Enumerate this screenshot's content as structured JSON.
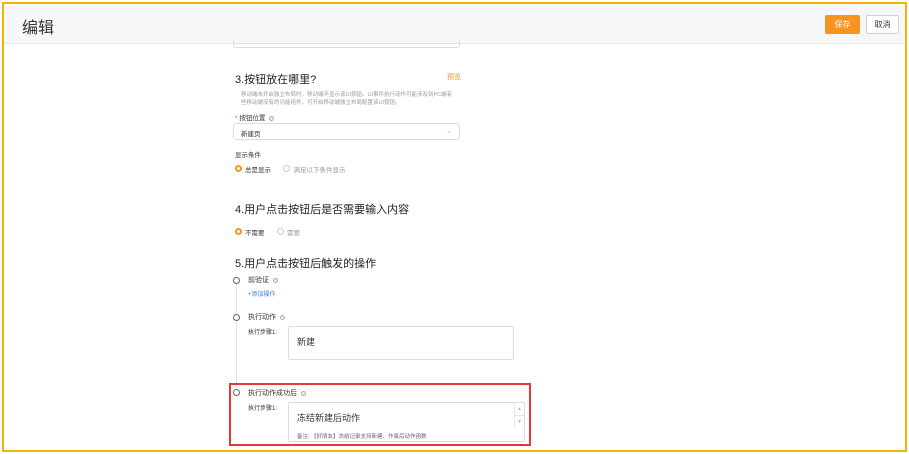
{
  "header": {
    "title": "编辑",
    "save_label": "保存",
    "cancel_label": "取消"
  },
  "section3": {
    "title": "3.按钮放在哪里?",
    "preview_label": "预览",
    "description_line1": "移动端未开启独立布局时，移动端不显示该UI按钮。UI事件执行动作可能涉及到PC端有",
    "description_line2": "些移动端没有的功能组件。可开启移动端独立布局配置该UI按钮。",
    "position_label": "按钮位置",
    "position_required": "*",
    "position_value": "新建页",
    "display_condition_label": "显示条件",
    "display_options": [
      {
        "label": "总是显示",
        "selected": true
      },
      {
        "label": "满足以下条件显示",
        "selected": false
      }
    ]
  },
  "section4": {
    "title": "4.用户点击按钮后是否需要输入内容",
    "options": [
      {
        "label": "不需要",
        "selected": true
      },
      {
        "label": "需要",
        "selected": false
      }
    ]
  },
  "section5": {
    "title": "5.用户点击按钮后触发的操作",
    "pre_validation_label": "前验证",
    "add_action_link": "+添加操作",
    "execute_action_label": "执行动作",
    "execute_step_label": "执行步骤1:",
    "execute_step_value": "新建",
    "after_success_label": "执行动作成功后",
    "after_step_label": "执行步骤1:",
    "after_step_value": "冻结新建后动作",
    "after_note": "备注: 【好朋友】冻结记录支持新建、作废后动作函数"
  },
  "colors": {
    "accent": "#f7931e",
    "frame_border": "#f5b400",
    "highlight_border": "#e53935",
    "link": "#3b7ddd"
  },
  "icons": {
    "help": "question-circle-icon",
    "dropdown": "chevron-down-icon",
    "spinner": "stepper-arrows-icon"
  }
}
